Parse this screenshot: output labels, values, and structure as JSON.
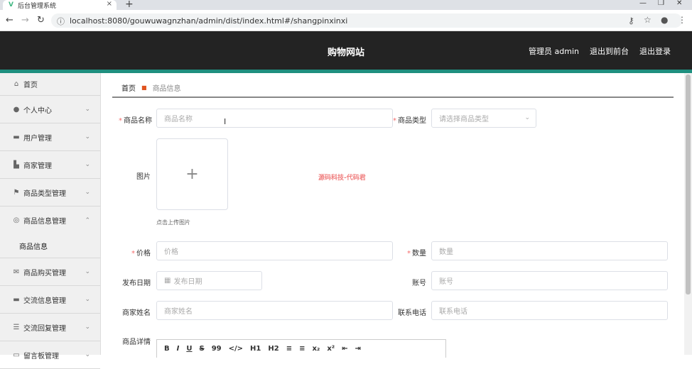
{
  "browser": {
    "tab_title": "后台管理系统",
    "tab_favicon": "V",
    "url": "localhost:8080/gouwuwagnzhan/admin/dist/index.html#/shangpinxinxi"
  },
  "header": {
    "site_title": "购物网站",
    "admin_label": "管理员 admin",
    "to_front_label": "退出到前台",
    "logout_label": "退出登录"
  },
  "sidebar": {
    "items": [
      {
        "label": "首页",
        "icon": "home-icon"
      },
      {
        "label": "个人中心",
        "icon": "user-icon"
      },
      {
        "label": "用户管理",
        "icon": "user-manage-icon"
      },
      {
        "label": "商家管理",
        "icon": "merchant-icon"
      },
      {
        "label": "商品类型管理",
        "icon": "flag-icon"
      },
      {
        "label": "商品信息管理",
        "icon": "info-icon"
      },
      {
        "label": "商品信息",
        "icon": ""
      },
      {
        "label": "商品购买管理",
        "icon": "mail-icon"
      },
      {
        "label": "交流信息管理",
        "icon": "chat-icon"
      },
      {
        "label": "交流回复管理",
        "icon": "sliders-icon"
      },
      {
        "label": "留言板管理",
        "icon": "message-icon"
      }
    ]
  },
  "breadcrumb": {
    "home": "首页",
    "current": "商品信息"
  },
  "form": {
    "name_label": "商品名称",
    "name_placeholder": "商品名称",
    "type_label": "商品类型",
    "type_placeholder": "请选择商品类型",
    "image_label": "图片",
    "upload_tip": "点击上传图片",
    "watermark": "源码科技-代码君",
    "price_label": "价格",
    "price_placeholder": "价格",
    "qty_label": "数量",
    "qty_placeholder": "数量",
    "date_label": "发布日期",
    "date_placeholder": "发布日期",
    "account_label": "账号",
    "account_placeholder": "账号",
    "merchant_label": "商家姓名",
    "merchant_placeholder": "商家姓名",
    "phone_label": "联系电话",
    "phone_placeholder": "联系电话",
    "detail_label": "商品详情"
  },
  "editor_toolbar": [
    "B",
    "I",
    "U",
    "S",
    "99",
    "</>",
    "H1",
    "H2",
    "≡",
    "≡",
    "x₂",
    "x²",
    "⇤",
    "⇥"
  ],
  "colors": {
    "header_bg": "#232323",
    "accent": "#1f8f7f",
    "required": "#f56c6c"
  }
}
